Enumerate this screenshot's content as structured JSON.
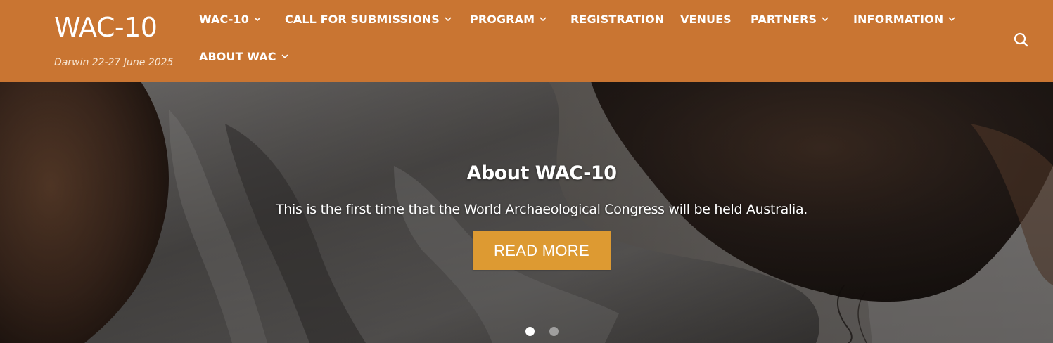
{
  "site": {
    "title": "WAC-10",
    "tagline": "Darwin 22-27 June 2025"
  },
  "nav": {
    "items": [
      {
        "label": "WAC-10",
        "has_dropdown": true
      },
      {
        "label": "CALL FOR SUBMISSIONS",
        "has_dropdown": true
      },
      {
        "label": "PROGRAM",
        "has_dropdown": true
      },
      {
        "label": "REGISTRATION",
        "has_dropdown": false
      },
      {
        "label": "VENUES",
        "has_dropdown": false
      },
      {
        "label": "PARTNERS",
        "has_dropdown": true
      },
      {
        "label": "INFORMATION",
        "has_dropdown": true
      },
      {
        "label": "ABOUT WAC",
        "has_dropdown": true
      }
    ],
    "search_icon": "search-icon"
  },
  "hero": {
    "title": "About WAC-10",
    "text": "This is the first time that the World Archaeological Congress will be held Australia.",
    "button_label": "READ MORE",
    "slides_count": 2,
    "active_slide": 1
  },
  "colors": {
    "header_bg": "#c97532",
    "button_bg": "#dd9a32",
    "text": "#ffffff"
  }
}
